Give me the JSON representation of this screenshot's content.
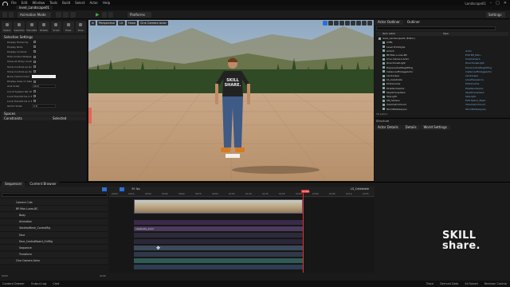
{
  "menu": [
    "File",
    "Edit",
    "Window",
    "Tools",
    "Build",
    "Select",
    "Actor",
    "Help"
  ],
  "app_title": "Landscape01",
  "level_tab": "level_Landscape01",
  "toolbar": {
    "mode": "Animation Mode",
    "platforms": "Platforms",
    "settings": "Settings"
  },
  "left_panel": {
    "tools": [
      "Select",
      "Selection",
      "Translate",
      "Rotate",
      "Scale",
      "Ease",
      "Pose"
    ],
    "section1": "Selection Settings",
    "props": [
      {
        "label": "Display Hierarchy",
        "value": ""
      },
      {
        "label": "Display Nulls",
        "value": ""
      },
      {
        "label": "Display Controls",
        "value": ""
      },
      {
        "label": "Hide Control Shapes",
        "value": ""
      },
      {
        "label": "Show All Proxy Controls",
        "value": ""
      },
      {
        "label": "Show Controls as Overlay",
        "value": ""
      },
      {
        "label": "Show Controls as Overlay",
        "value": ""
      },
      {
        "label": "Bone Control Color",
        "value": ""
      },
      {
        "label": "Display Axes on Selection",
        "value": ""
      },
      {
        "label": "Axis Scale",
        "value": "10.0"
      },
      {
        "label": "Coord System Per Widget",
        "value": ""
      },
      {
        "label": "Local Transforms in Each",
        "value": ""
      },
      {
        "label": "Local Transforms in Each",
        "value": ""
      },
      {
        "label": "Gizmo Scale",
        "value": "1.0"
      }
    ],
    "section2": "Spaces",
    "section3": "Constraints",
    "constraints_value": "Selected"
  },
  "viewport": {
    "buttons": [
      "Perspective",
      "Lit",
      "Show",
      "Cine Camera Actor"
    ],
    "tshirt_text_1": "SKILL",
    "tshirt_text_2": "SHARE."
  },
  "outliner": {
    "tabs": [
      "Actor Outliner",
      "Outliner"
    ],
    "header_item": "Item Label",
    "header_type": "Type",
    "rows": [
      {
        "label": "level_Landscape01 (Editor)",
        "type": ""
      },
      {
        "label": "Cliffs",
        "type": ""
      },
      {
        "label": "Level Prototype",
        "type": ""
      },
      {
        "label": "Actor2",
        "type": "Actor"
      },
      {
        "label": "BP-Man-Lucas-BC",
        "type": "Edit BP_Man..."
      },
      {
        "label": "Cine Camera Actor",
        "type": "CineCamera"
      },
      {
        "label": "DirectionalLight",
        "type": "DirectionalLight"
      },
      {
        "label": "ExponentialHeightFog",
        "type": "ExponentialHeightFog"
      },
      {
        "label": "InstancedFoliageActor",
        "type": "InstancedFoliageActor"
      },
      {
        "label": "Landscape",
        "type": "Landscape"
      },
      {
        "label": "LS_Celebrate",
        "type": "LevelSequence"
      },
      {
        "label": "PCGVolume",
        "type": "PCGVolume"
      },
      {
        "label": "PCGWorldActor",
        "type": "PCGWorldActor"
      },
      {
        "label": "SkyAtmosphere",
        "type": "SkyAtmosphere"
      },
      {
        "label": "SkyLight",
        "type": "SkyLight"
      },
      {
        "label": "SM_Sphere",
        "type": "Edit Spline_Mesh"
      },
      {
        "label": "VolumetricCloud",
        "type": "VolumetricCloud"
      },
      {
        "label": "WorldDataLayers",
        "type": "WorldDataLayers"
      }
    ],
    "count": "18 actors"
  },
  "details": {
    "title": "Structure",
    "tabs": [
      "Actor Details",
      "Details",
      "World Settings"
    ]
  },
  "sequencer": {
    "tabs": [
      "Sequencer",
      "Content Browser"
    ],
    "sequence_name": "LS_Celebrate",
    "fps": "30 fps",
    "tracks": [
      "Camera Cuts",
      "BP-Man-Lucas-BC",
      "Body",
      "Animation",
      "SkeletalMesh_ControlRig",
      "Face",
      "Face_ControlBoard_CtrlRig",
      "Sequence",
      "Transform",
      "Cine Camera Actor"
    ],
    "ruler_labels": [
      "0000",
      "0015",
      "0030",
      "0045",
      "0060",
      "0075",
      "0090",
      "0105",
      "0120",
      "0135",
      "0150",
      "0165",
      "0180",
      "0195",
      "0210",
      "0225"
    ],
    "playhead_label": "0240+",
    "clip_label": "celebrate_anim",
    "end_frames": [
      "0000",
      "0240"
    ]
  },
  "status": {
    "items": [
      "Content Drawer",
      "Output Log",
      "Cmd"
    ],
    "right": [
      "Trace",
      "Derived Data",
      "All Saved",
      "Revision Control"
    ]
  },
  "brand": {
    "line1": "SKILL",
    "line2": "share."
  }
}
